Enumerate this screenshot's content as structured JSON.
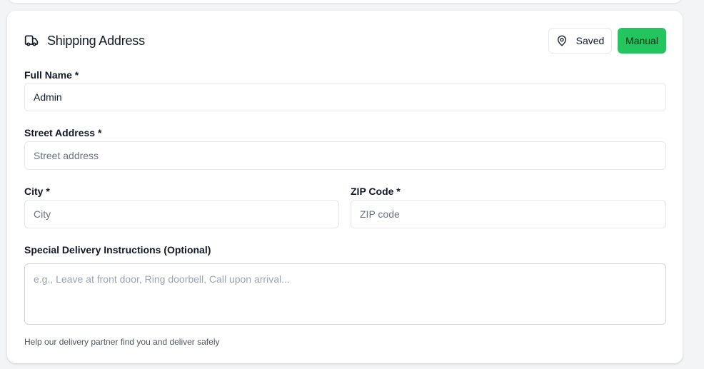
{
  "header": {
    "title": "Shipping Address",
    "icon": "truck-icon",
    "saved_label": "Saved",
    "saved_icon": "map-pin-icon",
    "manual_label": "Manual",
    "accent_color": "#22c55e"
  },
  "form": {
    "full_name": {
      "label": "Full Name *",
      "value": "Admin",
      "placeholder": ""
    },
    "street": {
      "label": "Street Address *",
      "value": "",
      "placeholder": "Street address"
    },
    "city": {
      "label": "City *",
      "value": "",
      "placeholder": "City"
    },
    "zip": {
      "label": "ZIP Code *",
      "value": "",
      "placeholder": "ZIP code"
    },
    "instructions": {
      "label": "Special Delivery Instructions (Optional)",
      "value": "",
      "placeholder": "e.g., Leave at front door, Ring doorbell, Call upon arrival...",
      "help": "Help our delivery partner find you and deliver safely"
    }
  }
}
